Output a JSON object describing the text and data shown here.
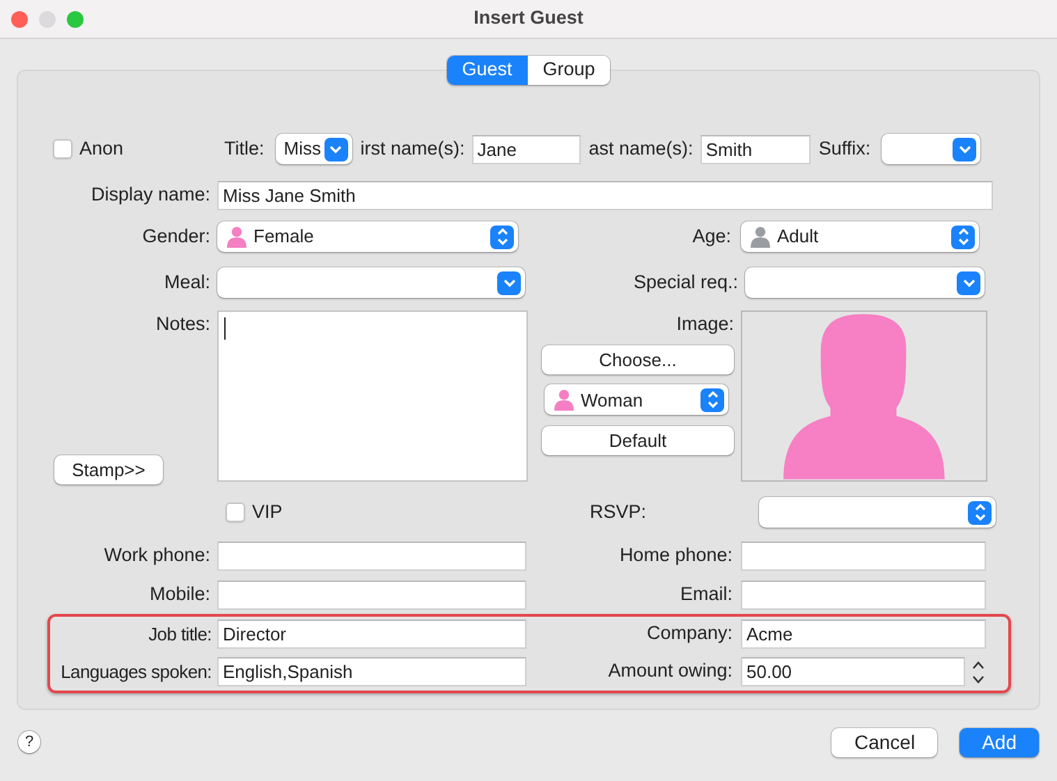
{
  "window": {
    "title": "Insert Guest"
  },
  "tabs": [
    {
      "label": "Guest",
      "selected": true
    },
    {
      "label": "Group",
      "selected": false
    }
  ],
  "top_row": {
    "anon": {
      "label": "Anon",
      "checked": false
    },
    "title": {
      "label": "Title:",
      "value": "Miss",
      "kind": "pulldown"
    },
    "first_name": {
      "label": "irst name(s):",
      "value": "Jane"
    },
    "last_name": {
      "label": "ast name(s):",
      "value": "Smith"
    },
    "suffix": {
      "label": "Suffix:",
      "kind": "pulldown"
    }
  },
  "display_name": {
    "label": "Display name:",
    "value": "Miss Jane Smith"
  },
  "gender": {
    "label": "Gender:",
    "value": "Female",
    "kind": "popup"
  },
  "age": {
    "label": "Age:",
    "value": "Adult",
    "kind": "popup"
  },
  "meal": {
    "label": "Meal:",
    "kind": "pulldown"
  },
  "special_req": {
    "label": "Special req.:",
    "kind": "pulldown"
  },
  "notes": {
    "label": "Notes:",
    "stamp_button": "Stamp>>"
  },
  "image": {
    "label": "Image:",
    "choose_button": "Choose...",
    "preset": {
      "value": "Woman",
      "kind": "popup"
    },
    "default_button": "Default"
  },
  "vip": {
    "label": "VIP",
    "checked": false
  },
  "rsvp": {
    "label": "RSVP:",
    "kind": "popup"
  },
  "contact_rows": [
    {
      "left": {
        "label": "Work phone:"
      },
      "right": {
        "label": "Home phone:"
      }
    },
    {
      "left": {
        "label": "Mobile:"
      },
      "right": {
        "label": "Email:"
      }
    }
  ],
  "highlighted_rows": [
    {
      "left": {
        "label": "Job title:",
        "value": "Director"
      },
      "right": {
        "label": "Company:",
        "value": "Acme"
      }
    },
    {
      "left": {
        "label": "Languages spoken:",
        "value": "English,Spanish"
      },
      "right": {
        "label": "Amount owing:",
        "value": "50.00",
        "kind": "stepper"
      }
    }
  ],
  "footer": {
    "help": "?",
    "buttons": [
      {
        "label": "Cancel",
        "kind": "secondary"
      },
      {
        "label": "Add",
        "kind": "primary"
      }
    ]
  }
}
